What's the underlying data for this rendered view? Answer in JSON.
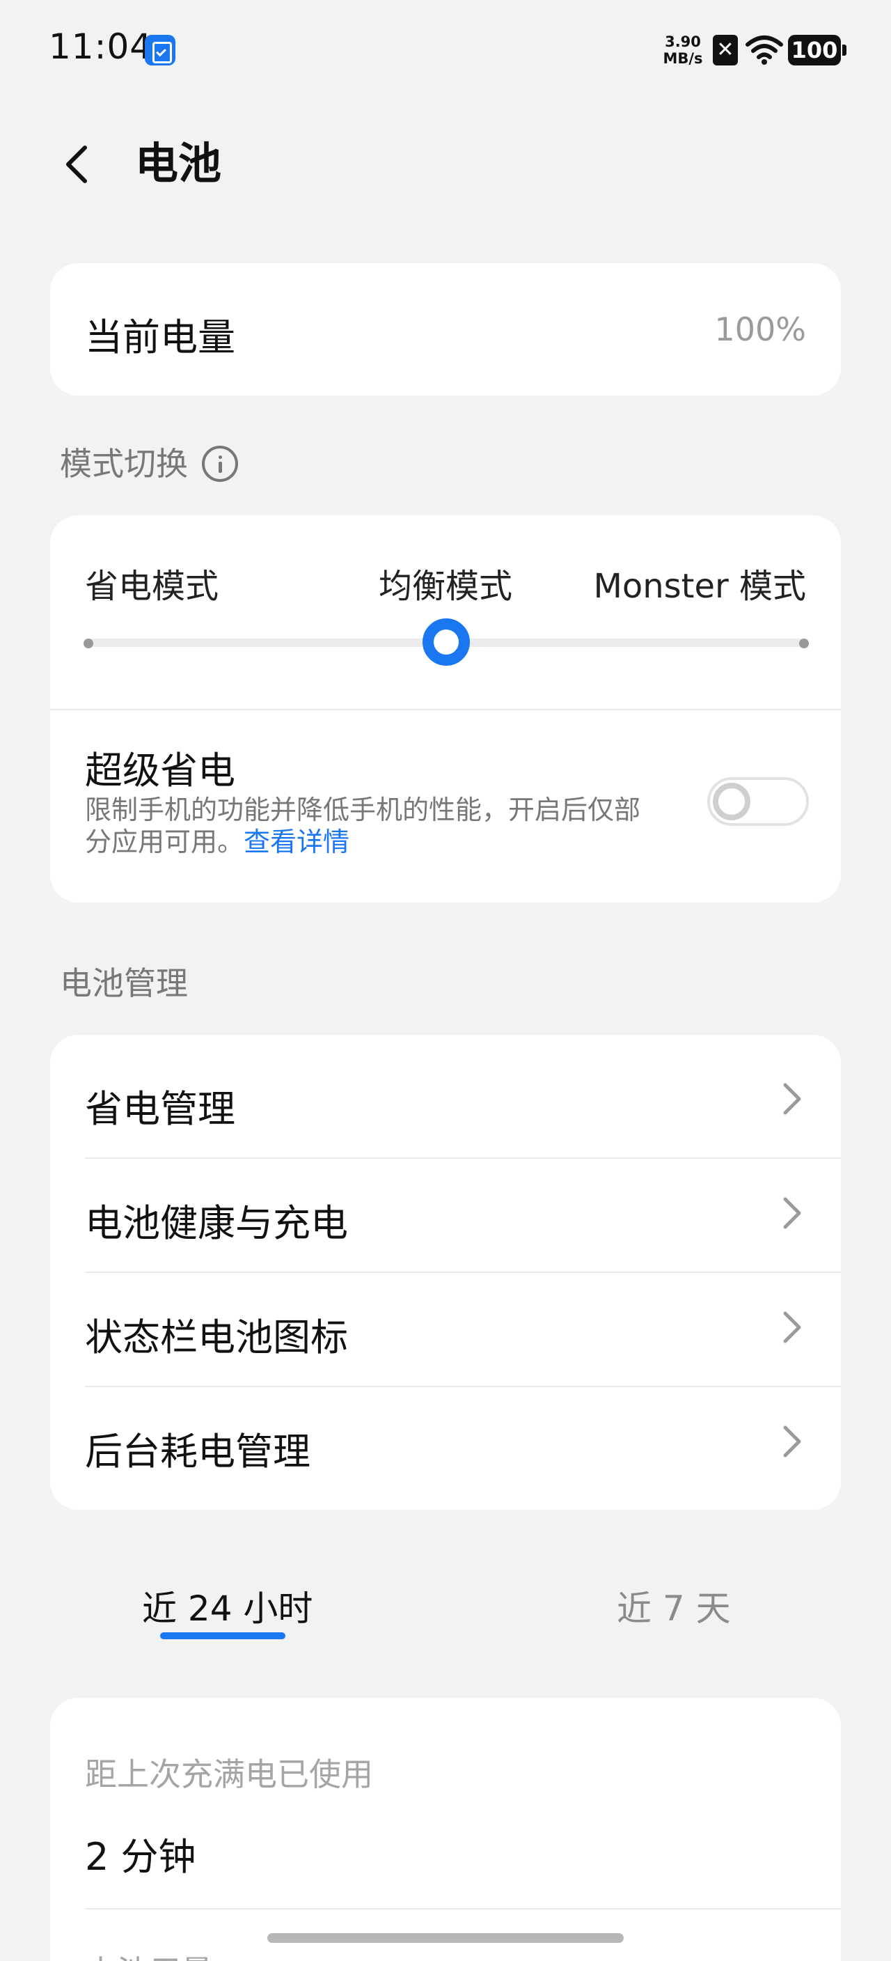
{
  "status_bar": {
    "time": "11:04",
    "app_icon": "clipboard-check-icon",
    "net_speed_value": "3.90",
    "net_speed_unit": "MB/s",
    "sim_icon": "no-sim-icon",
    "sim_glyph": "✕",
    "wifi_icon": "wifi-icon",
    "battery_level": "100"
  },
  "header": {
    "back_icon": "back-arrow-icon",
    "title": "电池"
  },
  "current_battery": {
    "label": "当前电量",
    "value": "100%"
  },
  "mode_section": {
    "title": "模式切换",
    "modes": [
      "省电模式",
      "均衡模式",
      "Monster 模式"
    ],
    "selected_index": 1,
    "super_saver": {
      "label": "超级省电",
      "description": "限制手机的功能并降低手机的性能，开启后仅部",
      "description_2": "分应用可用。",
      "link": "查看详情",
      "enabled": false
    }
  },
  "management_section": {
    "title": "电池管理",
    "items": [
      {
        "label": "省电管理"
      },
      {
        "label": "电池健康与充电"
      },
      {
        "label": "状态栏电池图标"
      },
      {
        "label": "后台耗电管理"
      }
    ]
  },
  "usage_tabs": {
    "tabs": [
      "近 24 小时",
      "近 7 天"
    ],
    "active_index": 0
  },
  "usage_card": {
    "since_label": "距上次充满电已使用",
    "since_value": "2 分钟",
    "next_label_partial": "电池用量"
  },
  "colors": {
    "accent": "#1b76f2",
    "background": "#f1f2f4",
    "card": "#ffffff",
    "secondary_text": "#777777"
  }
}
